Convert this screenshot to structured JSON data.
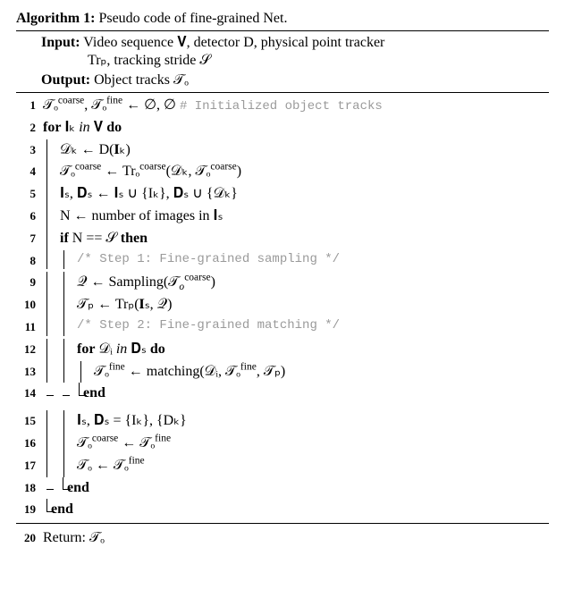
{
  "title_label": "Algorithm 1:",
  "title_text": "Pseudo code of fine-grained Net.",
  "input_label": "Input:",
  "input_text1": "Video sequence 𝐕, detector D, physical point tracker",
  "input_text2": "Trₚ, tracking stride 𝒮",
  "output_label": "Output:",
  "output_text": "Object tracks 𝒯ₒ",
  "lines": {
    "l1": "𝒯ₒ",
    "l1_sup1": "coarse",
    "l1_mid": ", 𝒯ₒ",
    "l1_sup2": "fine",
    "l1_rest": " ← ∅, ∅ ",
    "l1_comment": "# Initialized object tracks",
    "l2_for": "for",
    "l2_body": " 𝐈ₖ ",
    "l2_in": "in",
    "l2_body2": " 𝐕 ",
    "l2_do": "do",
    "l3": "𝒟ₖ ← D(𝐈ₖ)",
    "l4_a": "𝒯ₒ",
    "l4_sup1": "coarse",
    "l4_b": " ← Trₒ",
    "l4_sup2": "coarse",
    "l4_c": "(𝒟ₖ, 𝒯ₒ",
    "l4_sup3": "coarse",
    "l4_d": ")",
    "l5": "𝐈ₛ, 𝐃ₛ ← 𝐈ₛ ∪ {Iₖ}, 𝐃ₛ ∪ {𝒟ₖ}",
    "l6": "N ← number of images in 𝐈ₛ",
    "l7_if": "if",
    "l7_body": " N == 𝒮 ",
    "l7_then": "then",
    "l8": "/* Step 1:  Fine-grained sampling */",
    "l9_a": "𝒬 ← Sampling(𝒯",
    "l9_sub": "o",
    "l9_sup": "coarse",
    "l9_b": ")",
    "l10": "𝒯ₚ ← Trₚ(𝐈ₛ, 𝒬)",
    "l11": "/* Step 2:  Fine-grained matching */",
    "l12_for": "for",
    "l12_body": " 𝒟ᵢ ",
    "l12_in": "in",
    "l12_body2": " 𝐃ₛ ",
    "l12_do": "do",
    "l13_a": "𝒯ₒ",
    "l13_sup1": "fine",
    "l13_b": " ← matching(𝒟ᵢ, 𝒯ₒ",
    "l13_sup2": "fine",
    "l13_c": ", 𝒯ₚ)",
    "l14": "end",
    "l15": "𝐈ₛ, 𝐃ₛ = {Iₖ}, {Dₖ}",
    "l16_a": "𝒯ₒ",
    "l16_sup1": "coarse",
    "l16_b": " ← 𝒯ₒ",
    "l16_sup2": "fine",
    "l17_a": "𝒯ₒ ← 𝒯ₒ",
    "l17_sup": "fine",
    "l18": "end",
    "l19": "end",
    "l20": "Return: 𝒯ₒ"
  }
}
